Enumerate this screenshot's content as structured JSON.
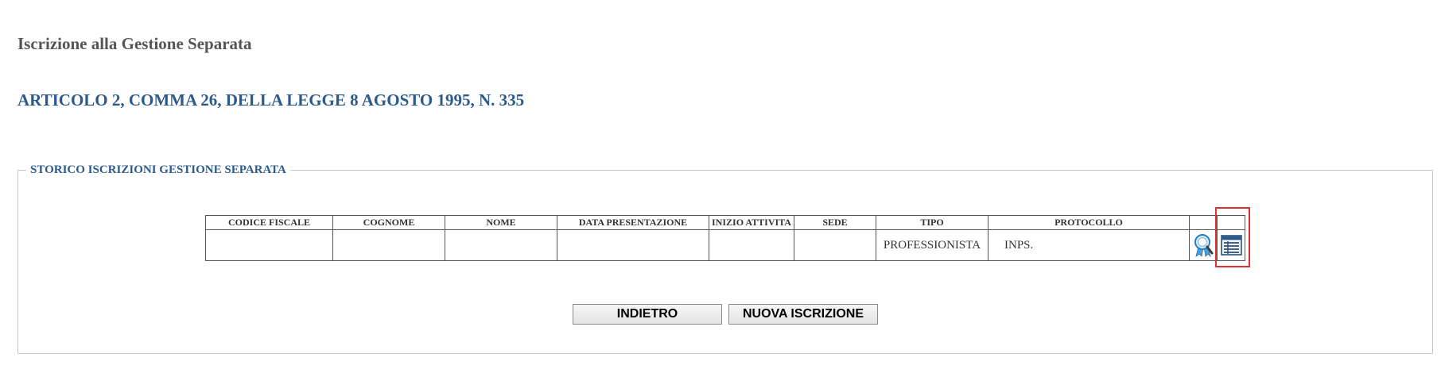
{
  "header": {
    "title": "Iscrizione alla Gestione Separata",
    "subtitle": "ARTICOLO 2, COMMA 26, DELLA LEGGE 8 AGOSTO 1995, N. 335"
  },
  "storico": {
    "legend": "STORICO ISCRIZIONI GESTIONE SEPARATA",
    "columns": [
      "CODICE FISCALE",
      "COGNOME",
      "NOME",
      "DATA PRESENTAZIONE",
      "INIZIO ATTIVITA",
      "SEDE",
      "TIPO",
      "PROTOCOLLO"
    ],
    "rows": [
      {
        "codice_fiscale": "",
        "cognome": "",
        "nome": "",
        "data_presentazione": "",
        "inizio_attivita": "",
        "sede": "",
        "tipo": "PROFESSIONISTA",
        "protocollo": "INPS.",
        "actions": [
          "magnifier-icon",
          "detail-list-icon"
        ]
      }
    ]
  },
  "buttons": {
    "back_label": "INDIETRO",
    "new_label": "NUOVA ISCRIZIONE"
  },
  "colors": {
    "title": "#555555",
    "accent_blue": "#2c5a8c",
    "highlight": "#e03030"
  }
}
